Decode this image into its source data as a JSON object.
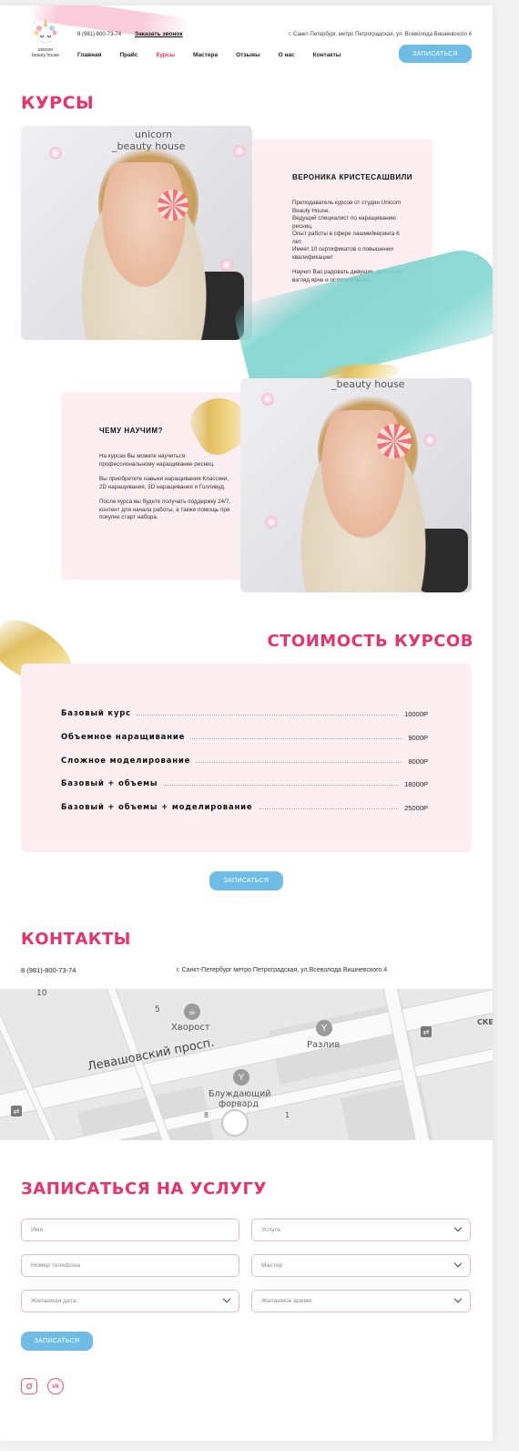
{
  "header": {
    "logo_line1": "unicorn",
    "logo_line2": "beauty house",
    "phone": "8 (981) 800-73-74",
    "call_link": "Заказать звонок",
    "address": "г. Санкт-Петербург, метро Петроградская, ул. Всеволода Вишневского 4",
    "nav": [
      "Главная",
      "Прайс",
      "Курсы",
      "Мастера",
      "Отзывы",
      "О нас",
      "Контакты"
    ],
    "active_nav": "Курсы",
    "cta": "ЗАПИСАТЬСЯ"
  },
  "courses": {
    "title": "КУРСЫ",
    "photo1_wall_line1": "unicorn",
    "photo1_wall_line2": "_beauty house",
    "photo2_wall_line": "_beauty house",
    "teacher_name": "ВЕРОНИКА КРИСТЕСАШВИЛИ",
    "teacher_bio": [
      "Преподаватель курсов от студии Unicorn Beauty House.",
      "Ведущий специалист по наращиванию ресниц.",
      "Опыт работы в сфере лашмейкеринга 6 лет.",
      "Имеет 10 сертификатов о повышении квалификации!",
      "Научит Вас радовать девушек, делать их взгляд ярче и ослепительнее."
    ],
    "learn_title": "ЧЕМУ НАУЧИМ?",
    "learn_text": [
      "На курсах Вы можете научиться профессиональному наращивание ресниц.",
      "Вы приобретете навыки наращивания Классики, 2D наращивания, 3D наращивания и Голливуд.",
      "После курса вы будете получать поддержку 24/7, контент для начала работы, а также помощь при покупке старт набора."
    ]
  },
  "prices": {
    "title": "СТОИМОСТЬ КУРСОВ",
    "items": [
      {
        "name": "Базовый курс",
        "price": "10000Р"
      },
      {
        "name": "Объемное наращивание",
        "price": "9000Р"
      },
      {
        "name": "Сложное моделирование",
        "price": "8000Р"
      },
      {
        "name": "Базовый + объемы",
        "price": "18000Р"
      },
      {
        "name": "Базовый + объемы + моделирование",
        "price": "25000Р"
      }
    ],
    "cta": "ЗАПИСАТЬСЯ"
  },
  "contacts": {
    "title": "КОНТАКТЫ",
    "phone": "8 (981)-800-73-74",
    "address": "г. Санкт-Петербург метро Петроградская, ул.Всеволода Вишневского 4",
    "map_labels": {
      "street": "Левашовский просп.",
      "place1": "Хворост",
      "place2": "Разлив",
      "place3_line1": "Блуждающий",
      "place3_line2": "форвард",
      "num10": "10",
      "num5": "5",
      "num8": "8",
      "num1": "1",
      "sk": "СКЕ"
    }
  },
  "booking": {
    "title": "ЗАПИСАТЬСЯ НА УСЛУГУ",
    "name_placeholder": "Имя",
    "service_placeholder": "Услуга",
    "phone_placeholder": "Номер телефона",
    "master_placeholder": "Мастер",
    "date_placeholder": "Желаемая дата",
    "time_placeholder": "Желаемое время",
    "submit": "ЗАПИСАТЬСЯ"
  },
  "social": {
    "instagram_icon": "instagram-icon",
    "vk_icon": "vk-icon",
    "vk_label": "vk"
  },
  "colors": {
    "accent": "#e8326b",
    "button": "#6fbde6",
    "card_bg": "#fdeef1"
  }
}
